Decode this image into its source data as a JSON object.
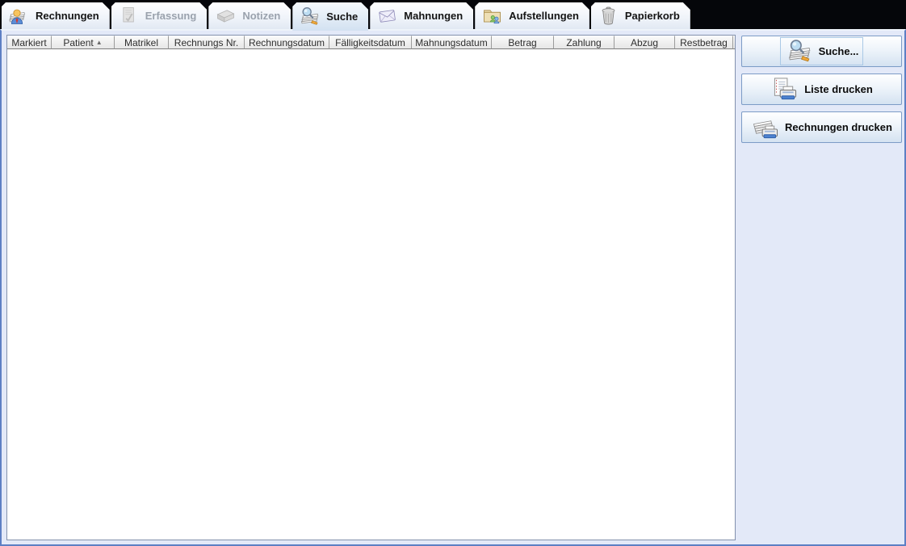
{
  "tabs": [
    {
      "label": "Rechnungen",
      "icon": "invoices-person-icon",
      "state": "normal"
    },
    {
      "label": "Erfassung",
      "icon": "document-edit-icon",
      "state": "disabled"
    },
    {
      "label": "Notizen",
      "icon": "notes-icon",
      "state": "disabled"
    },
    {
      "label": "Suche",
      "icon": "search-invoices-icon",
      "state": "selected"
    },
    {
      "label": "Mahnungen",
      "icon": "envelope-icon",
      "state": "normal"
    },
    {
      "label": "Aufstellungen",
      "icon": "folder-users-icon",
      "state": "normal"
    },
    {
      "label": "Papierkorb",
      "icon": "trash-icon",
      "state": "normal"
    }
  ],
  "table": {
    "columns": [
      {
        "label": "Markiert"
      },
      {
        "label": "Patient",
        "sort_indicator": "▲"
      },
      {
        "label": "Matrikel"
      },
      {
        "label": "Rechnungs Nr."
      },
      {
        "label": "Rechnungsdatum"
      },
      {
        "label": "Fälligkeitsdatum"
      },
      {
        "label": "Mahnungsdatum"
      },
      {
        "label": "Betrag"
      },
      {
        "label": "Zahlung"
      },
      {
        "label": "Abzug"
      },
      {
        "label": "Restbetrag"
      }
    ],
    "rows": []
  },
  "actions": [
    {
      "label": "Suche...",
      "icon": "search-invoices-icon",
      "focused": true
    },
    {
      "label": "Liste drucken",
      "icon": "print-list-icon",
      "focused": false
    },
    {
      "label": "Rechnungen drucken",
      "icon": "print-invoices-icon",
      "focused": false
    }
  ],
  "colors": {
    "window_border": "#5d7fc4",
    "tabbar_background": "#05060a",
    "content_background": "#e3e9f8",
    "table_panel_border": "#8291ad",
    "button_border": "#7c9bc6",
    "disabled_tab_text": "#9aa2ad",
    "focus_rect": "#aac9e6"
  }
}
